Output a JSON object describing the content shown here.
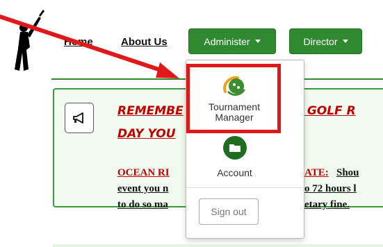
{
  "nav": {
    "home": "Home",
    "about": "About Us",
    "administer": "Administer",
    "director": "Director"
  },
  "alert": {
    "line1_left": "REMEMBE",
    "line1_right": "UR GOLF R",
    "line2": "DAY YOU",
    "ocean_left": "OCEAN RI",
    "ocean_right": "ATE:",
    "ocean_right2": "Shou",
    "event_left": "event you n",
    "event_right": "o 72 hours l",
    "todo_left": "to do so ma",
    "todo_right": "etary fine."
  },
  "dropdown": {
    "tournament_label": "Tournament Manager",
    "account_label": "Account",
    "signout_label": "Sign out"
  },
  "colors": {
    "brand_green": "#2f8a2f",
    "alert_red": "#c00000",
    "annotation_red": "#e01818"
  }
}
